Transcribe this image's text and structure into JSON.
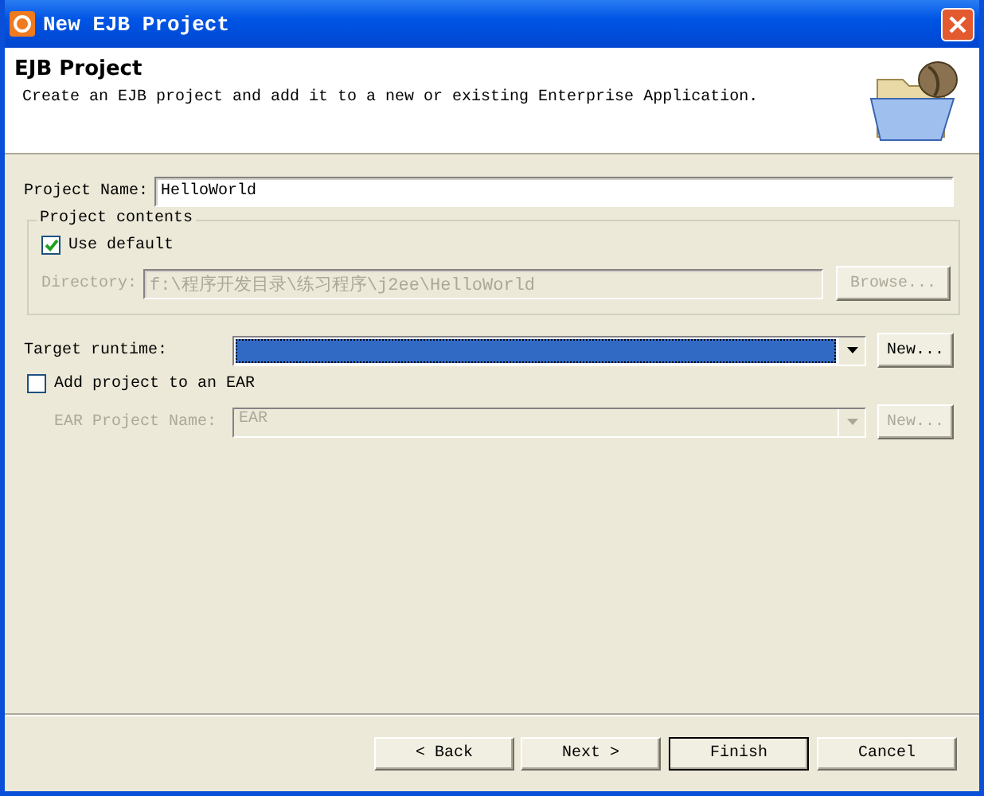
{
  "window": {
    "title": "New EJB Project"
  },
  "header": {
    "title": "EJB Project",
    "description": "Create an EJB project and add it to a new or existing Enterprise Application."
  },
  "project_name": {
    "label": "Project Name:",
    "value": "HelloWorld"
  },
  "project_contents": {
    "legend": "Project contents",
    "use_default": {
      "label": "Use default",
      "checked": true
    },
    "directory": {
      "label": "Directory:",
      "value": "f:\\程序开发目录\\练习程序\\j2ee\\HelloWorld",
      "disabled": true
    },
    "browse_button": {
      "label": "Browse...",
      "disabled": true
    }
  },
  "target_runtime": {
    "label": "Target runtime:",
    "focused": true,
    "new_button": {
      "label": "New...",
      "disabled": false
    }
  },
  "add_to_ear": {
    "label": "Add project to an EAR",
    "checked": false
  },
  "ear_project": {
    "label": "EAR Project Name:",
    "value": "EAR",
    "disabled": true,
    "new_button": {
      "label": "New...",
      "disabled": true
    }
  },
  "buttons": [
    {
      "label": "< Back",
      "default": false
    },
    {
      "label": "Next >",
      "default": false
    },
    {
      "label": "Finish",
      "default": true
    },
    {
      "label": "Cancel",
      "default": false
    }
  ]
}
